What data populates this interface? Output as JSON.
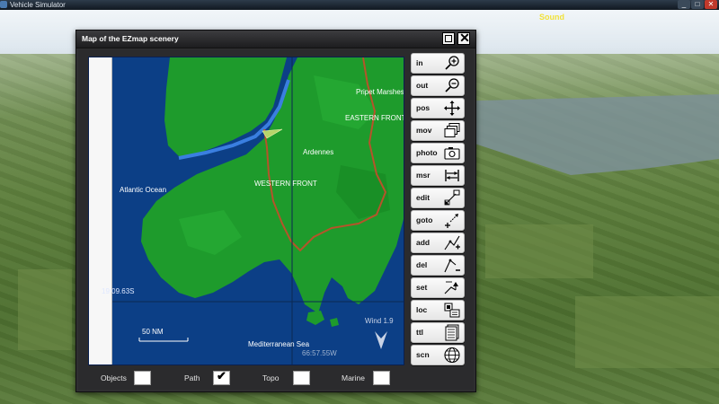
{
  "app": {
    "title": "Vehicle Simulator",
    "window_buttons": [
      "_",
      "□",
      "✕"
    ]
  },
  "hud": {
    "sound_label": "Sound"
  },
  "dialog": {
    "title": "Map of the EZmap scenery",
    "restore_icon": "restore-icon",
    "close_icon": "close-icon"
  },
  "map": {
    "labels": {
      "atlantic": "Atlantic Ocean",
      "pripet": "Pripet Marshes",
      "eastern_front": "EASTERN FRONT",
      "ardennes": "Ardennes",
      "western_front": "WESTERN FRONT",
      "mediterranean": "Mediterranean Sea",
      "lat_coord": "19:09.63S",
      "lon_coord": "66:57.55W",
      "wind": "Wind 1.9",
      "scale": "50 NM"
    },
    "colors": {
      "sea": "#0c3f86",
      "land": "#1e9b2c",
      "front_line": "#b5542a",
      "river": "#3a7fe0"
    }
  },
  "options": [
    {
      "label": "Objects",
      "checked": false
    },
    {
      "label": "Path",
      "checked": true
    },
    {
      "label": "Topo",
      "checked": false
    },
    {
      "label": "Marine",
      "checked": false
    }
  ],
  "toolbar": [
    {
      "label": "in",
      "icon": "zoom-in-icon"
    },
    {
      "label": "out",
      "icon": "zoom-out-icon"
    },
    {
      "label": "pos",
      "icon": "move-arrows-icon"
    },
    {
      "label": "mov",
      "icon": "stacked-windows-icon"
    },
    {
      "label": "photo",
      "icon": "camera-icon"
    },
    {
      "label": "msr",
      "icon": "measure-icon"
    },
    {
      "label": "edit",
      "icon": "resize-icon"
    },
    {
      "label": "goto",
      "icon": "goto-icon"
    },
    {
      "label": "add",
      "icon": "add-point-icon"
    },
    {
      "label": "del",
      "icon": "delete-point-icon"
    },
    {
      "label": "set",
      "icon": "set-point-icon"
    },
    {
      "label": "loc",
      "icon": "location-icon"
    },
    {
      "label": "ttl",
      "icon": "document-icon"
    },
    {
      "label": "scn",
      "icon": "globe-icon"
    }
  ]
}
